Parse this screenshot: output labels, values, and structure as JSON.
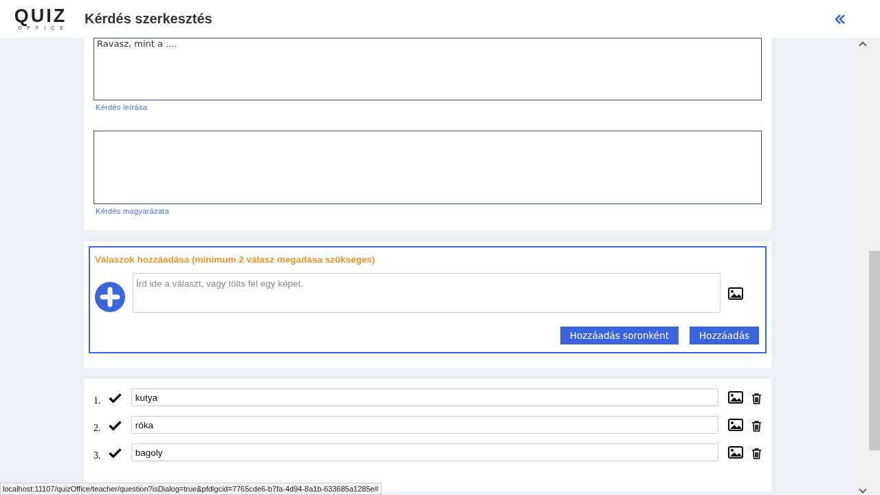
{
  "header": {
    "logo_word": "QUIZ",
    "logo_sub": "OFFICE",
    "title": "Kérdés szerkesztés"
  },
  "question": {
    "description": {
      "value": "Ravasz, mint a ....",
      "label": "Kérdés leírása"
    },
    "explanation": {
      "label": "Kérdés magyarázata"
    }
  },
  "add_answers": {
    "title": "Válaszok hozzáadása (minimum 2 válasz megadása szükséges)",
    "placeholder": "Írd ide a választ, vagy tölts fel egy képet.",
    "buttons": [
      "Hozzáadás soronként",
      "Hozzáadás"
    ]
  },
  "answers": [
    {
      "number": "1.",
      "text": "kutya",
      "correct": true
    },
    {
      "number": "2.",
      "text": "róka",
      "correct": true
    },
    {
      "number": "3.",
      "text": "bagoly",
      "correct": true
    }
  ],
  "status_bar": "localhost:11107/quizOffice/teacher/question?isDialog=true&pfdlgcid=7765cde6-b7fa-4d94-8a1b-633685a1285e#"
}
